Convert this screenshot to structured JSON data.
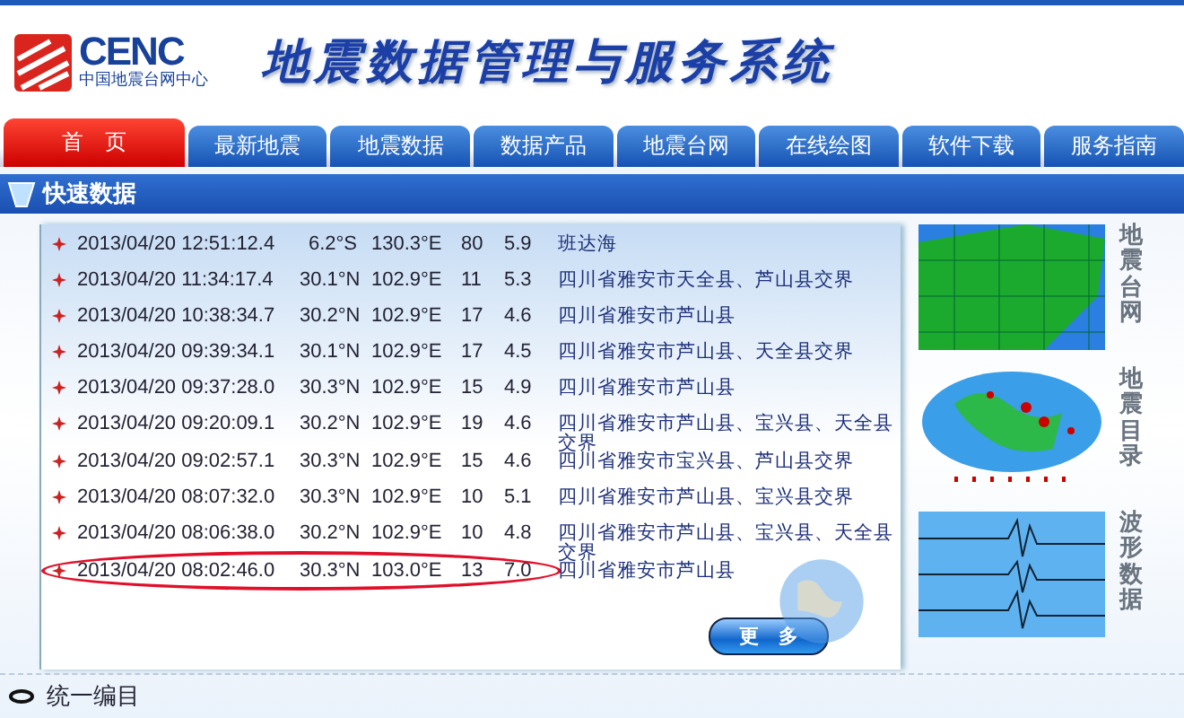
{
  "header": {
    "logo_text": "CENC",
    "logo_subtitle": "中国地震台网中心",
    "title": "地震数据管理与服务系统"
  },
  "tabs": [
    {
      "label": "首　页",
      "selected": true
    },
    {
      "label": "最新地震",
      "selected": false
    },
    {
      "label": "地震数据",
      "selected": false
    },
    {
      "label": "数据产品",
      "selected": false
    },
    {
      "label": "地震台网",
      "selected": false
    },
    {
      "label": "在线绘图",
      "selected": false
    },
    {
      "label": "软件下载",
      "selected": false
    },
    {
      "label": "服务指南",
      "selected": false
    }
  ],
  "section_title": "快速数据",
  "table": {
    "rows": [
      {
        "time": "2013/04/20 12:51:12.4",
        "lat": "6.2°S",
        "lon": "130.3°E",
        "depth": "80",
        "mag": "5.9",
        "location": "班达海",
        "circled": false
      },
      {
        "time": "2013/04/20 11:34:17.4",
        "lat": "30.1°N",
        "lon": "102.9°E",
        "depth": "11",
        "mag": "5.3",
        "location": "四川省雅安市天全县、芦山县交界",
        "circled": false
      },
      {
        "time": "2013/04/20 10:38:34.7",
        "lat": "30.2°N",
        "lon": "102.9°E",
        "depth": "17",
        "mag": "4.6",
        "location": "四川省雅安市芦山县",
        "circled": false
      },
      {
        "time": "2013/04/20 09:39:34.1",
        "lat": "30.1°N",
        "lon": "102.9°E",
        "depth": "17",
        "mag": "4.5",
        "location": "四川省雅安市芦山县、天全县交界",
        "circled": false
      },
      {
        "time": "2013/04/20 09:37:28.0",
        "lat": "30.3°N",
        "lon": "102.9°E",
        "depth": "15",
        "mag": "4.9",
        "location": "四川省雅安市芦山县",
        "circled": false
      },
      {
        "time": "2013/04/20 09:20:09.1",
        "lat": "30.2°N",
        "lon": "102.9°E",
        "depth": "19",
        "mag": "4.6",
        "location": "四川省雅安市芦山县、宝兴县、天全县交界",
        "circled": false
      },
      {
        "time": "2013/04/20 09:02:57.1",
        "lat": "30.3°N",
        "lon": "102.9°E",
        "depth": "15",
        "mag": "4.6",
        "location": "四川省雅安市宝兴县、芦山县交界",
        "circled": false
      },
      {
        "time": "2013/04/20 08:07:32.0",
        "lat": "30.3°N",
        "lon": "102.9°E",
        "depth": "10",
        "mag": "5.1",
        "location": "四川省雅安市芦山县、宝兴县交界",
        "circled": false
      },
      {
        "time": "2013/04/20 08:06:38.0",
        "lat": "30.2°N",
        "lon": "102.9°E",
        "depth": "10",
        "mag": "4.8",
        "location": "四川省雅安市芦山县、宝兴县、天全县交界",
        "circled": false
      },
      {
        "time": "2013/04/20 08:02:46.0",
        "lat": "30.3°N",
        "lon": "103.0°E",
        "depth": "13",
        "mag": "7.0",
        "location": "四川省雅安市芦山县",
        "circled": true
      }
    ]
  },
  "more_button": "更　多",
  "side_links": [
    {
      "kind": "network",
      "label": "地震台网"
    },
    {
      "kind": "catalog",
      "label": "地震目录"
    },
    {
      "kind": "waveform",
      "label": "波形数据"
    }
  ],
  "footer_link": "统一编目"
}
